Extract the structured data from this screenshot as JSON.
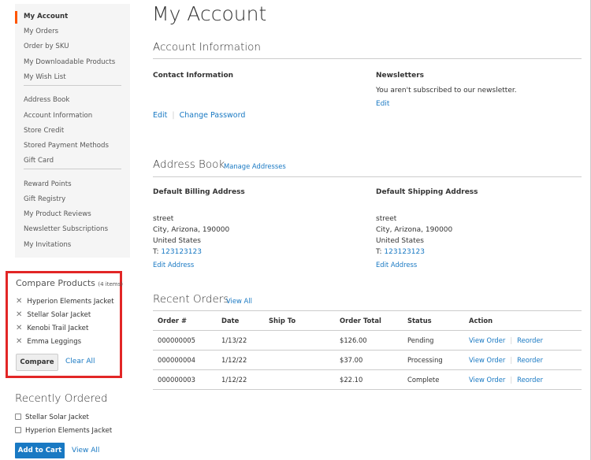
{
  "sidebar": {
    "groups": [
      [
        "My Account",
        "My Orders",
        "Order by SKU",
        "My Downloadable Products",
        "My Wish List"
      ],
      [
        "Address Book",
        "Account Information",
        "Store Credit",
        "Stored Payment Methods",
        "Gift Card"
      ],
      [
        "Reward Points",
        "Gift Registry",
        "My Product Reviews",
        "Newsletter Subscriptions",
        "My Invitations"
      ]
    ],
    "active": "My Account",
    "accent_color": "#ff5501"
  },
  "compare": {
    "title": "Compare Products",
    "count": "(4 items)",
    "items": [
      "Hyperion Elements Jacket",
      "Stellar Solar Jacket",
      "Kenobi Trail Jacket",
      "Emma Leggings"
    ],
    "remove_icon": "close-icon",
    "compare_label": "Compare",
    "clear_label": "Clear All",
    "highlight_color": "#e22626"
  },
  "recent": {
    "title": "Recently Ordered",
    "items": [
      "Stellar Solar Jacket",
      "Hyperion Elements Jacket"
    ],
    "add_label": "Add to Cart",
    "view_all": "View All"
  },
  "main": {
    "title": "My Account",
    "account_info": {
      "title": "Account Information",
      "contact_title": "Contact Information",
      "edit": "Edit",
      "change_password": "Change Password",
      "news_title": "Newsletters",
      "news_text": "You aren't subscribed to our newsletter.",
      "news_edit": "Edit"
    },
    "address_book": {
      "title": "Address Book",
      "manage": "Manage Addresses",
      "billing": {
        "title": "Default Billing Address",
        "street": "street",
        "city": "City, Arizona, 190000",
        "country": "United States",
        "phone_prefix": "T:",
        "phone": "123123123",
        "edit": "Edit Address"
      },
      "shipping": {
        "title": "Default Shipping Address",
        "street": "street",
        "city": "City, Arizona, 190000",
        "country": "United States",
        "phone_prefix": "T:",
        "phone": "123123123",
        "edit": "Edit Address"
      }
    },
    "orders": {
      "title": "Recent Orders",
      "view_all": "View All",
      "columns": [
        "Order #",
        "Date",
        "Ship To",
        "Order Total",
        "Status",
        "Action"
      ],
      "rows": [
        {
          "id": "000000005",
          "date": "1/13/22",
          "ship_to": "",
          "total": "$126.00",
          "status": "Pending"
        },
        {
          "id": "000000004",
          "date": "1/12/22",
          "ship_to": "",
          "total": "$37.00",
          "status": "Processing"
        },
        {
          "id": "000000003",
          "date": "1/12/22",
          "ship_to": "",
          "total": "$22.10",
          "status": "Complete"
        }
      ],
      "view_order": "View Order",
      "reorder": "Reorder"
    }
  },
  "link_color": "#1979c3"
}
